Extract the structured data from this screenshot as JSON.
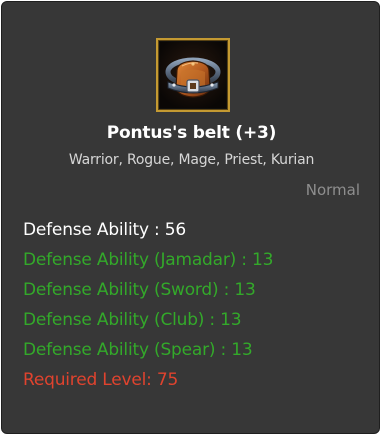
{
  "item": {
    "icon": "belt-icon",
    "name": "Pontus's belt (+3)",
    "classes": "Warrior, Rogue, Mage, Priest, Kurian",
    "grade": "Normal"
  },
  "stats": [
    {
      "text": "Defense Ability : 56",
      "color": "#ffffff"
    },
    {
      "text": "Defense Ability (Jamadar) : 13",
      "color": "#33a92a"
    },
    {
      "text": "Defense Ability (Sword) : 13",
      "color": "#33a92a"
    },
    {
      "text": "Defense Ability (Club) : 13",
      "color": "#33a92a"
    },
    {
      "text": "Defense Ability (Spear) : 13",
      "color": "#33a92a"
    },
    {
      "text": "Required Level: 75",
      "color": "#e0432e"
    }
  ],
  "colors": {
    "background": "#373737",
    "icon_border": "#c49a32"
  }
}
